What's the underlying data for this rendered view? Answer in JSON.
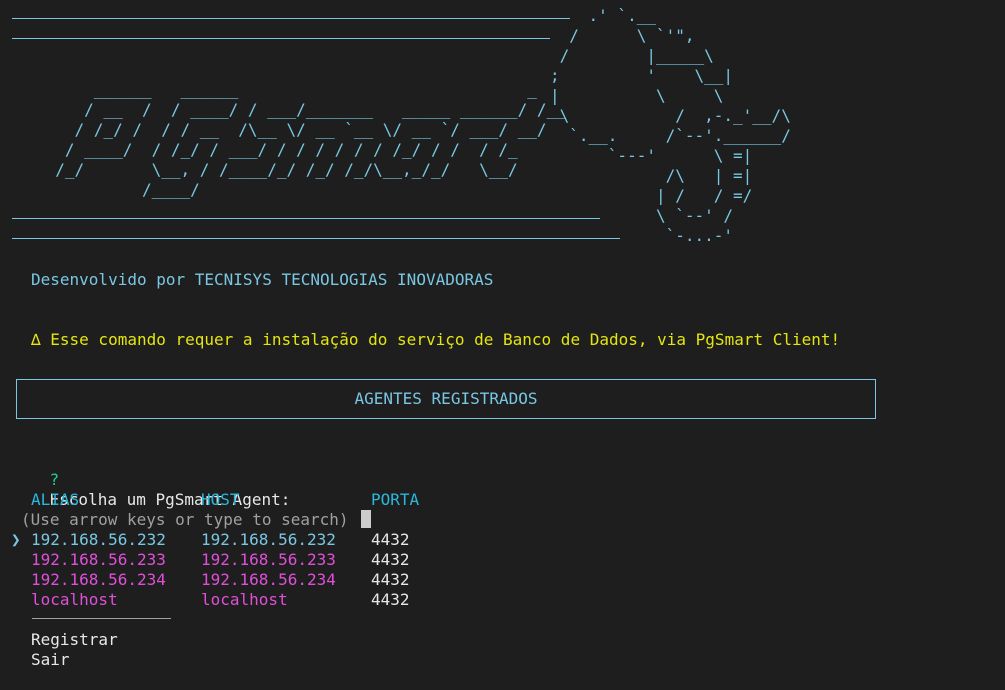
{
  "banner": {
    "logo_text": "PgSmart",
    "ascii_left": "      ______   ______                              _\n     / __  /  / ____/ / ___/_______   _____ ______/ /__\n    / /_/ /  / / __  /\\__ \\/ __ `__ \\/ __ `/ ___/ __/\n   / ____/  / /_/ / ___/ / / / / / / /_/ / /  / /_\n  /_/       \\__, / /____/_/ /_/ /_/\\__,_/_/   \\__/\n           /____/",
    "ascii_right": "    .' `.__\n  /      \\ `'\",\n /        |_____\\\n;         '    \\__|\n|          \\     \\\n \\           /  ,-._'__/\\\n  `.__.     /`--'.______/\n      `---'      \\ =|\n            /\\   | =|\n           | /   / =/\n           \\ `--' /\n            `-...-'"
  },
  "developer_line": "Desenvolvido por TECNISYS TECNOLOGIAS INOVADORAS",
  "warning_line": "∆ Esse comando requer a instalação do serviço de Banco de Dados, via PgSmart Client!",
  "section_box_title": "AGENTES REGISTRADOS",
  "prompt": {
    "mark": "?",
    "question": "Escolha um PgSmart Agent:",
    "hint": "(Use arrow keys or type to search)",
    "pointer": "❯"
  },
  "table": {
    "headers": [
      "ALIAS",
      "HOST",
      "PORTA"
    ],
    "rows": [
      {
        "alias": "192.168.56.232",
        "host": "192.168.56.232",
        "port": "4432"
      },
      {
        "alias": "192.168.56.233",
        "host": "192.168.56.233",
        "port": "4432"
      },
      {
        "alias": "192.168.56.234",
        "host": "192.168.56.234",
        "port": "4432"
      },
      {
        "alias": "localhost",
        "host": "localhost",
        "port": "4432"
      }
    ],
    "selected_index": 0
  },
  "menu": {
    "register": "Registrar",
    "exit": "Sair"
  },
  "colors": {
    "background": "#1e1e1e",
    "ascii": "#79c7e3",
    "warning": "#e5e510",
    "question_mark": "#23d18b",
    "header": "#29b8db",
    "unselected_option": "#e04fd8"
  }
}
